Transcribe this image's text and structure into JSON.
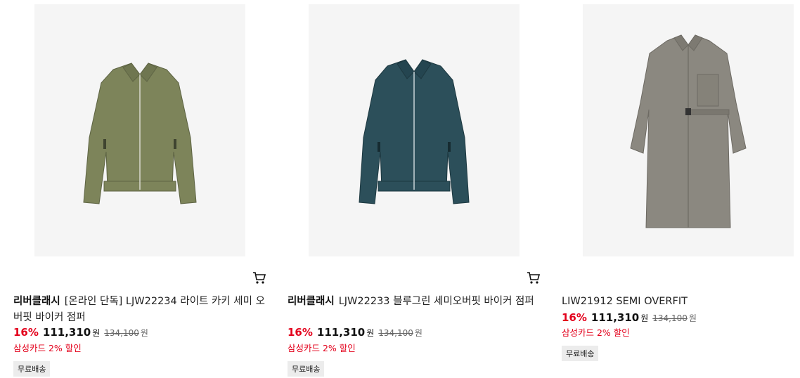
{
  "products": [
    {
      "brand": "리버클래시",
      "name": "[온라인 단독] LJW22234 라이트 카키 세미 오버핏 바이커 점퍼",
      "discount": "16%",
      "price": "111,310",
      "currency": "원",
      "original_price": "134,100",
      "promo": "삼성카드 2% 할인",
      "badge": "무료배송",
      "image_icon": "khaki-jacket",
      "color": "#7d845a"
    },
    {
      "brand": "리버클래시",
      "name": "LJW22233 블루그린 세미오버핏 바이커 점퍼",
      "discount": "16%",
      "price": "111,310",
      "currency": "원",
      "original_price": "134,100",
      "promo": "삼성카드 2% 할인",
      "badge": "무료배송",
      "image_icon": "blue-green-jacket",
      "color": "#2c4f5a"
    },
    {
      "brand": "",
      "name": "LIW21912 SEMI OVERFIT",
      "discount": "16%",
      "price": "111,310",
      "currency": "원",
      "original_price": "134,100",
      "promo": "삼성카드 2% 할인",
      "badge": "무료배송",
      "image_icon": "grey-coat",
      "color": "#8b8880"
    }
  ],
  "cart_icon": "cart-icon"
}
